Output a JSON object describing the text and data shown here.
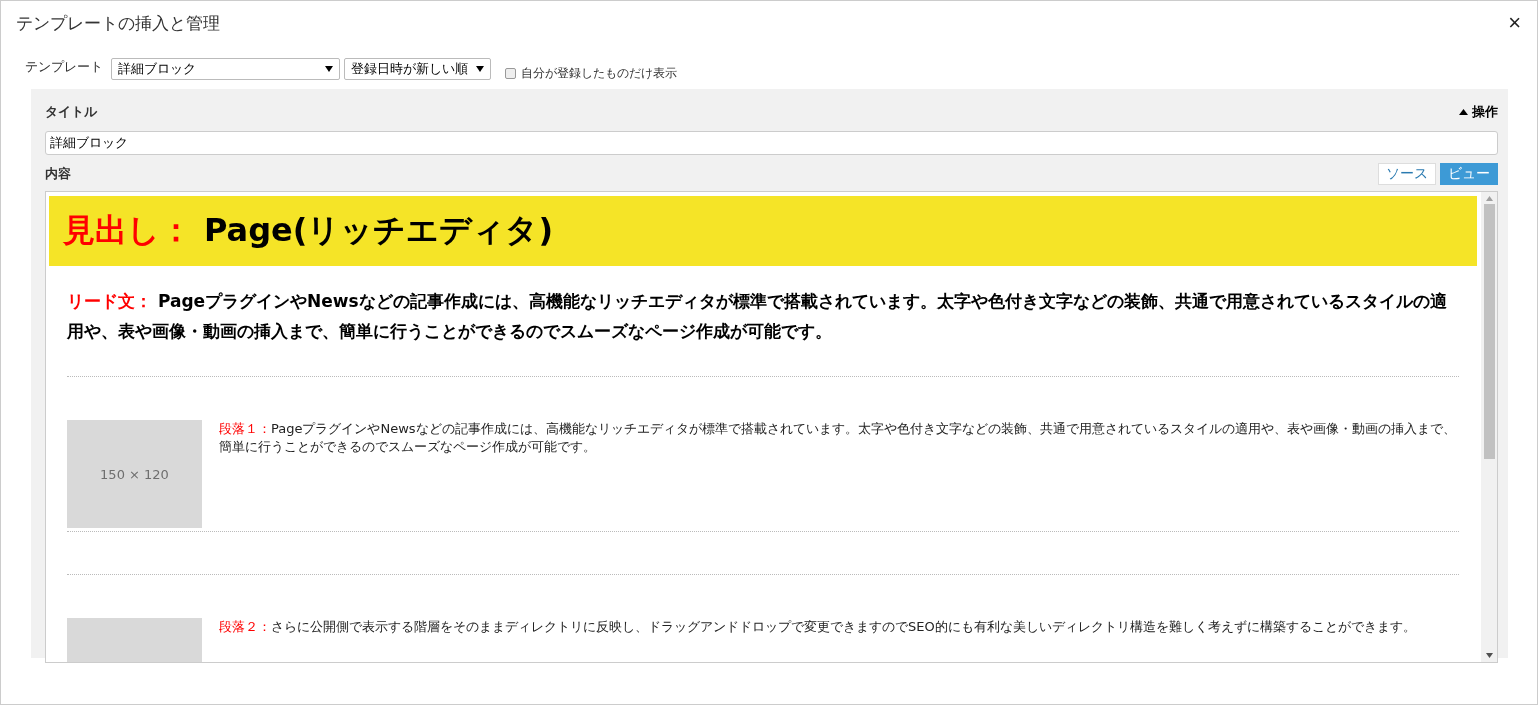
{
  "window": {
    "title": "テンプレートの挿入と管理",
    "close": "×"
  },
  "toolbar": {
    "label": "テンプレート",
    "template_select": "詳細ブロック",
    "sort_select": "登録日時が新しい順",
    "own_only": {
      "label": "自分が登録したものだけ表示",
      "checked": false
    }
  },
  "form": {
    "title_label": "タイトル",
    "actions": {
      "label": "操作",
      "expanded": true
    },
    "title_value": "詳細ブロック",
    "content_label": "内容",
    "modes": [
      {
        "label": "ソース",
        "selected": false
      },
      {
        "label": "ビュー",
        "selected": true
      }
    ]
  },
  "editor": {
    "heading": {
      "label": "見出し：",
      "text": "Page(リッチエディタ)"
    },
    "lead": {
      "label": "リード文：",
      "text": "PageプラグインやNewsなどの記事作成には、高機能なリッチエディタが標準で搭載されています。太字や色付き文字などの装飾、共通で用意されているスタイルの適用や、表や画像・動画の挿入まで、簡単に行うことができるのでスムーズなページ作成が可能です。"
    },
    "paragraphs": [
      {
        "image_label": "150 × 120",
        "label": "段落１：",
        "text": "PageプラグインやNewsなどの記事作成には、高機能なリッチエディタが標準で搭載されています。太字や色付き文字などの装飾、共通で用意されているスタイルの適用や、表や画像・動画の挿入まで、簡単に行うことができるのでスムーズなページ作成が可能です。"
      },
      {
        "label": "段落２：",
        "text": "さらに公開側で表示する階層をそのままディレクトリに反映し、ドラッグアンドドロップで変更できますのでSEO的にも有利な美しいディレクトリ構造を難しく考えずに構築することができます。"
      }
    ]
  }
}
